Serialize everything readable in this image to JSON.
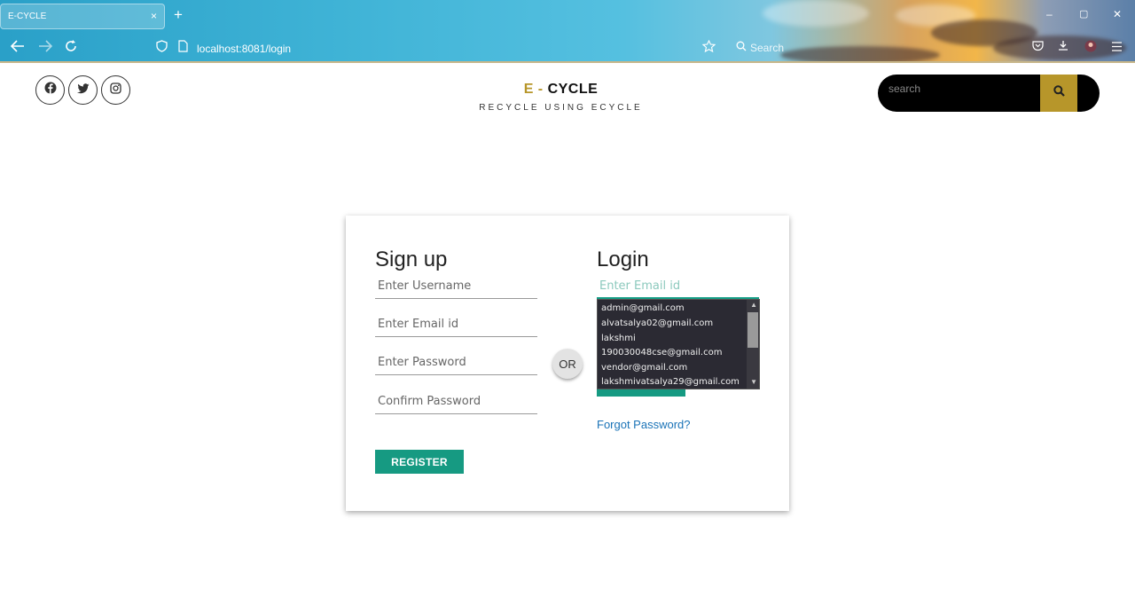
{
  "browser": {
    "tab_title": "E-CYCLE",
    "tab_close": "×",
    "new_tab": "+",
    "url": "localhost:8081/login",
    "search_placeholder": "Search",
    "window_minimize": "–",
    "window_maximize": "▢",
    "window_close": "✕"
  },
  "header": {
    "brand_e": "E",
    "brand_dash": " - ",
    "brand_cycle": "CYCLE",
    "tagline": "RECYCLE USING ECYCLE",
    "search_placeholder": "search",
    "social": [
      "facebook-icon",
      "twitter-icon",
      "instagram-icon"
    ]
  },
  "signup": {
    "heading": "Sign up",
    "username_placeholder": "Enter Username",
    "email_placeholder": "Enter Email id",
    "password_placeholder": "Enter Password",
    "confirm_placeholder": "Confirm Password",
    "register_label": "REGISTER"
  },
  "or_label": "OR",
  "login": {
    "heading": "Login",
    "email_placeholder": "Enter Email id",
    "forgot_label": "Forgot Password?",
    "suggestions": [
      "admin@gmail.com",
      "alvatsalya02@gmail.com",
      "lakshmi",
      "190030048cse@gmail.com",
      "vendor@gmail.com",
      "lakshmivatsalya29@gmail.com"
    ]
  },
  "colors": {
    "accent_gold": "#b7962a",
    "accent_teal": "#169a82",
    "link_blue": "#1a73b7"
  }
}
